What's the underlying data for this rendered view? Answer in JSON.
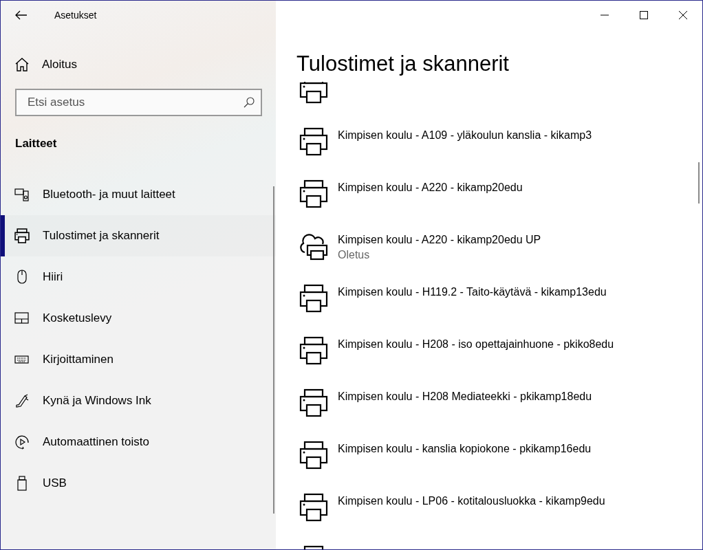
{
  "window": {
    "title": "Asetukset"
  },
  "sidebar": {
    "home": {
      "label": "Aloitus"
    },
    "search": {
      "placeholder": "Etsi asetus"
    },
    "section": "Laitteet",
    "items": [
      {
        "label": "Bluetooth- ja muut laitteet",
        "selected": false
      },
      {
        "label": "Tulostimet ja skannerit",
        "selected": true
      },
      {
        "label": "Hiiri",
        "selected": false
      },
      {
        "label": "Kosketuslevy",
        "selected": false
      },
      {
        "label": "Kirjoittaminen",
        "selected": false
      },
      {
        "label": "Kynä ja Windows Ink",
        "selected": false
      },
      {
        "label": "Automaattinen toisto",
        "selected": false
      },
      {
        "label": "USB",
        "selected": false
      }
    ]
  },
  "page": {
    "title": "Tulostimet ja skannerit",
    "printers": [
      {
        "kind": "printer",
        "name": "Kimpisen koulu - A109 - yläkoulun kanslia - kikamp3"
      },
      {
        "kind": "printer",
        "name": "Kimpisen koulu - A220 - kikamp20edu"
      },
      {
        "kind": "cloud",
        "name": "Kimpisen koulu - A220 - kikamp20edu UP",
        "status": "Oletus"
      },
      {
        "kind": "printer",
        "name": "Kimpisen koulu - H119.2 - Taito-käytävä - kikamp13edu"
      },
      {
        "kind": "printer",
        "name": "Kimpisen koulu - H208 - iso opettajainhuone - pkiko8edu"
      },
      {
        "kind": "printer",
        "name": "Kimpisen koulu - H208 Mediateekki - pkikamp18edu"
      },
      {
        "kind": "printer",
        "name": "Kimpisen koulu - kanslia kopiokone - pkikamp16edu"
      },
      {
        "kind": "printer",
        "name": "Kimpisen koulu - LP06 - kotitalousluokka - kikamp9edu"
      }
    ]
  }
}
